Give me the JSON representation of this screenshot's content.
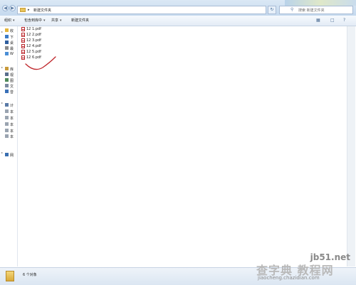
{
  "window": {
    "breadcrumb": "新建文件夹",
    "search_placeholder": "搜索 新建文件夹"
  },
  "toolbar": {
    "organize": "组织",
    "include_in_library": "包含到库中",
    "share": "共享",
    "new_folder": "新建文件夹"
  },
  "navpane": {
    "items": [
      {
        "label": "收",
        "icon": "star-icon"
      },
      {
        "label": "下",
        "icon": "download-icon"
      },
      {
        "label": "桌",
        "icon": "desktop-icon"
      },
      {
        "label": "最",
        "icon": "recent-icon"
      },
      {
        "label": "W",
        "icon": "cloud-icon"
      },
      {
        "label": "库",
        "icon": "library-icon"
      },
      {
        "label": "视",
        "icon": "video-icon"
      },
      {
        "label": "图",
        "icon": "picture-icon"
      },
      {
        "label": "文",
        "icon": "document-icon"
      },
      {
        "label": "音",
        "icon": "music-icon"
      },
      {
        "label": "计",
        "icon": "computer-icon"
      },
      {
        "label": "本",
        "icon": "drive-icon"
      },
      {
        "label": "本",
        "icon": "drive-icon"
      },
      {
        "label": "本",
        "icon": "drive-icon"
      },
      {
        "label": "本",
        "icon": "drive-icon"
      },
      {
        "label": "本",
        "icon": "drive-icon"
      },
      {
        "label": "网",
        "icon": "network-icon"
      }
    ]
  },
  "files": [
    {
      "name": "12 1.pdf"
    },
    {
      "name": "12 2.pdf"
    },
    {
      "name": "12 3.pdf"
    },
    {
      "name": "12 4.pdf"
    },
    {
      "name": "12 5.pdf"
    },
    {
      "name": "12 6.pdf"
    }
  ],
  "status": {
    "item_count": "6 个对象"
  },
  "watermark": {
    "url": "jb51.net",
    "main": "查字典 教程网",
    "sub": "jiaocheng.chazidian.com"
  },
  "colors": {
    "annotation": "#c0282d",
    "pdf_icon": "#b8252a"
  }
}
